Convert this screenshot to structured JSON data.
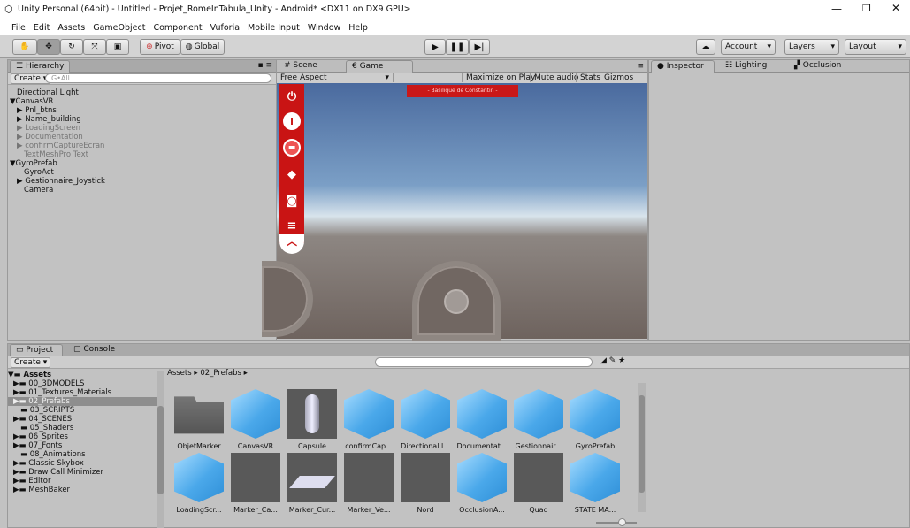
{
  "window": {
    "title": "Unity Personal (64bit) - Untitled - Projet_RomeInTabula_Unity - Android* <DX11 on DX9 GPU>"
  },
  "menu": [
    "File",
    "Edit",
    "Assets",
    "GameObject",
    "Component",
    "Vuforia",
    "Mobile Input",
    "Window",
    "Help"
  ],
  "toolbar": {
    "pivot": "Pivot",
    "global": "Global",
    "account": "Account",
    "layers": "Layers",
    "layout": "Layout"
  },
  "hierarchy": {
    "tab": "Hierarchy",
    "create": "Create",
    "search": "G•All",
    "items": [
      "Directional Light",
      "CanvasVR",
      "Pnl_btns",
      "Name_building",
      "LoadingScreen",
      "Documentation",
      "confirmCaptureEcran",
      "TextMeshPro Text",
      "GyroPrefab",
      "GyroAct",
      "Gestionnaire_Joystick",
      "Camera"
    ]
  },
  "view": {
    "scene_tab": "Scene",
    "game_tab": "Game",
    "aspect": "Free Aspect",
    "maximize": "Maximize on Play",
    "mute": "Mute audio",
    "stats": "Stats",
    "gizmos": "Gizmos",
    "banner": "- Basilique de Constantin -"
  },
  "inspector": {
    "tab1": "Inspector",
    "tab2": "Lighting",
    "tab3": "Occlusion"
  },
  "project": {
    "tab1": "Project",
    "tab2": "Console",
    "create": "Create",
    "breadcrumb": "Assets ▸ 02_Prefabs ▸",
    "folders": [
      "Assets",
      "00_3DMODELS",
      "01_Textures_Materials",
      "02_Prefabs",
      "03_SCRIPTS",
      "04_SCENES",
      "05_Shaders",
      "06_Sprites",
      "07_Fonts",
      "08_Animations",
      "Classic Skybox",
      "Draw Call Minimizer",
      "Editor",
      "MeshBaker"
    ],
    "assets": [
      "ObjetMarker",
      "CanvasVR",
      "Capsule",
      "confirmCap...",
      "Directional l...",
      "Documentat...",
      "Gestionnair...",
      "GyroPrefab",
      "LoadingScr...",
      "Marker_Ca...",
      "Marker_Cur...",
      "Marker_Ve...",
      "Nord",
      "OcclusionA...",
      "Quad",
      "STATE MA..."
    ]
  }
}
